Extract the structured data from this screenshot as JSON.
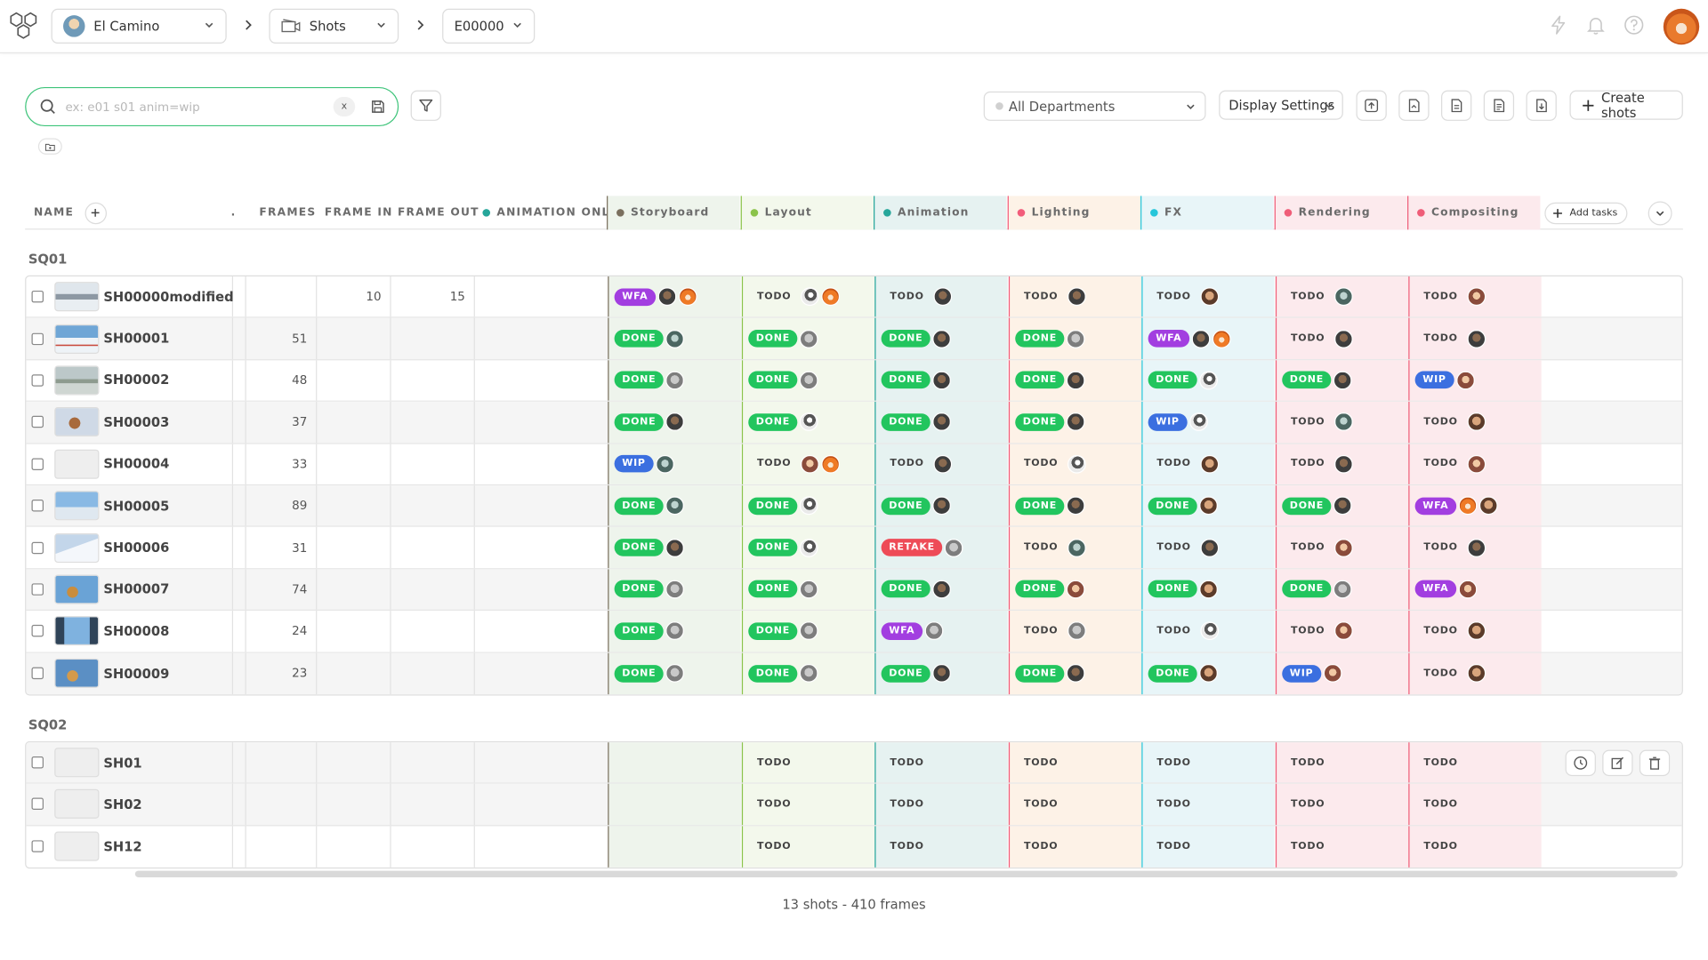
{
  "topbar": {
    "production": "El Camino",
    "section": "Shots",
    "episode": "E00000"
  },
  "toolbar": {
    "search_placeholder": "ex: e01 s01 anim=wip",
    "clear_label": "x",
    "department_select": "All Departments",
    "display_settings": "Display Settings",
    "create_shots": "Create shots"
  },
  "table": {
    "headers": {
      "name": "NAME",
      "frames": "FRAMES",
      "frame_in": "FRAME IN",
      "frame_out": "FRAME OUT",
      "animation_only": "ANIMATION ONLY",
      "add_tasks": "Add tasks"
    },
    "task_columns": [
      {
        "name": "Storyboard",
        "color": "#7a6f5e",
        "bg": "#eef4ec"
      },
      {
        "name": "Layout",
        "color": "#8bc34a",
        "bg": "#f3f8ec"
      },
      {
        "name": "Animation",
        "color": "#26a69a",
        "bg": "#e6f2f1"
      },
      {
        "name": "Lighting",
        "color": "#f25c7a",
        "bg": "#fdf2e7"
      },
      {
        "name": "FX",
        "color": "#26c6da",
        "bg": "#e8f5f8"
      },
      {
        "name": "Rendering",
        "color": "#ef5d78",
        "bg": "#fceaed"
      },
      {
        "name": "Compositing",
        "color": "#ef5d78",
        "bg": "#fceaed"
      }
    ],
    "sequences": [
      {
        "name": "SQ01",
        "shots": [
          {
            "name": "SH00000modified",
            "frames": "",
            "frame_in": "10",
            "frame_out": "15",
            "thumb": "mountain",
            "tasks": [
              [
                "WFA",
                "a,d"
              ],
              [
                "TODO",
                "g,d"
              ],
              [
                "TODO",
                "a"
              ],
              [
                "TODO",
                "a"
              ],
              [
                "TODO",
                "e"
              ],
              [
                "TODO",
                "h"
              ],
              [
                "TODO",
                "c"
              ]
            ]
          },
          {
            "name": "SH00001",
            "frames": "51",
            "frame_in": "",
            "frame_out": "",
            "thumb": "snow",
            "tasks": [
              [
                "DONE",
                "h"
              ],
              [
                "DONE",
                "b"
              ],
              [
                "DONE",
                "a"
              ],
              [
                "DONE",
                "b"
              ],
              [
                "WFA",
                "a,d"
              ],
              [
                "TODO",
                "a"
              ],
              [
                "TODO",
                "a"
              ]
            ]
          },
          {
            "name": "SH00002",
            "frames": "48",
            "frame_in": "",
            "frame_out": "",
            "thumb": "haze",
            "tasks": [
              [
                "DONE",
                "b"
              ],
              [
                "DONE",
                "b"
              ],
              [
                "DONE",
                "a"
              ],
              [
                "DONE",
                "a"
              ],
              [
                "DONE",
                "g"
              ],
              [
                "DONE",
                "a"
              ],
              [
                "WIP",
                "c"
              ]
            ]
          },
          {
            "name": "SH00003",
            "frames": "37",
            "frame_in": "",
            "frame_out": "",
            "thumb": "char",
            "tasks": [
              [
                "DONE",
                "a"
              ],
              [
                "DONE",
                "g"
              ],
              [
                "DONE",
                "a"
              ],
              [
                "DONE",
                "a"
              ],
              [
                "WIP",
                "g"
              ],
              [
                "TODO",
                "h"
              ],
              [
                "TODO",
                "e"
              ]
            ]
          },
          {
            "name": "SH00004",
            "frames": "33",
            "frame_in": "",
            "frame_out": "",
            "thumb": "",
            "tasks": [
              [
                "WIP",
                "h"
              ],
              [
                "TODO",
                "c,d"
              ],
              [
                "TODO",
                "a"
              ],
              [
                "TODO",
                "g"
              ],
              [
                "TODO",
                "e"
              ],
              [
                "TODO",
                "a"
              ],
              [
                "TODO",
                "c"
              ]
            ]
          },
          {
            "name": "SH00005",
            "frames": "89",
            "frame_in": "",
            "frame_out": "",
            "thumb": "sky",
            "tasks": [
              [
                "DONE",
                "h"
              ],
              [
                "DONE",
                "g"
              ],
              [
                "DONE",
                "a"
              ],
              [
                "DONE",
                "a"
              ],
              [
                "DONE",
                "e"
              ],
              [
                "DONE",
                "a"
              ],
              [
                "WFA",
                "d,e"
              ]
            ]
          },
          {
            "name": "SH00006",
            "frames": "31",
            "frame_in": "",
            "frame_out": "",
            "thumb": "snow2",
            "tasks": [
              [
                "DONE",
                "a"
              ],
              [
                "DONE",
                "g"
              ],
              [
                "RETAKE",
                "b"
              ],
              [
                "TODO",
                "h"
              ],
              [
                "TODO",
                "a"
              ],
              [
                "TODO",
                "c"
              ],
              [
                "TODO",
                "a"
              ]
            ]
          },
          {
            "name": "SH00007",
            "frames": "74",
            "frame_in": "",
            "frame_out": "",
            "thumb": "char2",
            "tasks": [
              [
                "DONE",
                "b"
              ],
              [
                "DONE",
                "b"
              ],
              [
                "DONE",
                "a"
              ],
              [
                "DONE",
                "c"
              ],
              [
                "DONE",
                "e"
              ],
              [
                "DONE",
                "b"
              ],
              [
                "WFA",
                "c"
              ]
            ]
          },
          {
            "name": "SH00008",
            "frames": "24",
            "frame_in": "",
            "frame_out": "",
            "thumb": "window",
            "tasks": [
              [
                "DONE",
                "b"
              ],
              [
                "DONE",
                "b"
              ],
              [
                "WFA",
                "b"
              ],
              [
                "TODO",
                "b"
              ],
              [
                "TODO",
                "g"
              ],
              [
                "TODO",
                "c"
              ],
              [
                "TODO",
                "e"
              ]
            ]
          },
          {
            "name": "SH00009",
            "frames": "23",
            "frame_in": "",
            "frame_out": "",
            "thumb": "char3",
            "tasks": [
              [
                "DONE",
                "b"
              ],
              [
                "DONE",
                "b"
              ],
              [
                "DONE",
                "a"
              ],
              [
                "DONE",
                "a"
              ],
              [
                "DONE",
                "e"
              ],
              [
                "WIP",
                "c"
              ],
              [
                "TODO",
                "e"
              ]
            ]
          }
        ]
      },
      {
        "name": "SQ02",
        "shots": [
          {
            "name": "SH01",
            "frames": "",
            "frame_in": "",
            "frame_out": "",
            "thumb": "",
            "tasks": [
              [
                "",
                ""
              ],
              [
                "TODO",
                ""
              ],
              [
                "TODO",
                ""
              ],
              [
                "TODO",
                ""
              ],
              [
                "TODO",
                ""
              ],
              [
                "TODO",
                ""
              ],
              [
                "TODO",
                ""
              ]
            ]
          },
          {
            "name": "SH02",
            "frames": "",
            "frame_in": "",
            "frame_out": "",
            "thumb": "",
            "tasks": [
              [
                "",
                ""
              ],
              [
                "TODO",
                ""
              ],
              [
                "TODO",
                ""
              ],
              [
                "TODO",
                ""
              ],
              [
                "TODO",
                ""
              ],
              [
                "TODO",
                ""
              ],
              [
                "TODO",
                ""
              ]
            ]
          },
          {
            "name": "SH12",
            "frames": "",
            "frame_in": "",
            "frame_out": "",
            "thumb": "",
            "tasks": [
              [
                "",
                ""
              ],
              [
                "TODO",
                ""
              ],
              [
                "TODO",
                ""
              ],
              [
                "TODO",
                ""
              ],
              [
                "TODO",
                ""
              ],
              [
                "TODO",
                ""
              ],
              [
                "TODO",
                ""
              ]
            ]
          }
        ]
      }
    ]
  },
  "footer": {
    "summary": "13 shots - 410 frames"
  }
}
